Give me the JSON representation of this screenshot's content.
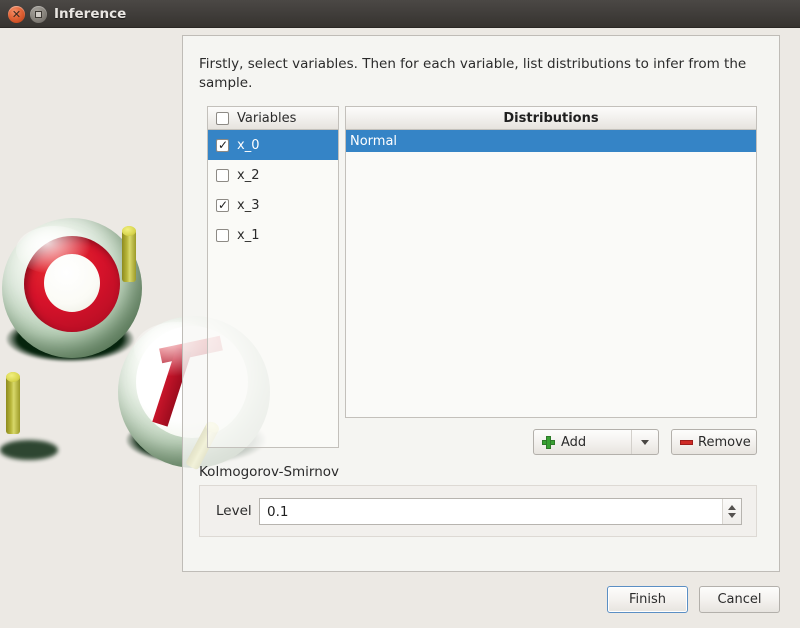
{
  "window": {
    "title": "Inference",
    "close_icon": "close-icon",
    "maximize_icon": "maximize-icon"
  },
  "content": {
    "intro": "Firstly, select variables. Then for each variable, list distributions to infer from the sample."
  },
  "variables_panel": {
    "header_label": "Variables",
    "header_checked": false,
    "rows": [
      {
        "label": "x_0",
        "checked": true,
        "selected": true
      },
      {
        "label": "x_2",
        "checked": false,
        "selected": false
      },
      {
        "label": "x_3",
        "checked": true,
        "selected": false
      },
      {
        "label": "x_1",
        "checked": false,
        "selected": false
      }
    ]
  },
  "distributions_panel": {
    "header_label": "Distributions",
    "rows": [
      {
        "label": "Normal",
        "selected": true
      }
    ],
    "add_button": {
      "label": "Add",
      "icon": "plus-icon",
      "dropdown_icon": "chevron-down-icon"
    },
    "remove_button": {
      "label": "Remove",
      "icon": "minus-icon"
    }
  },
  "kolmogorov_smirnov": {
    "group_label": "Kolmogorov-Smirnov",
    "level_label": "Level",
    "level_value": "0.1"
  },
  "actions": {
    "finish_label": "Finish",
    "cancel_label": "Cancel"
  },
  "colors": {
    "selection_blue": "#3584c6",
    "dialog_background": "#ece9e4",
    "titlebar": "#413e3b",
    "close_button": "#e5693c",
    "add_icon_green": "#38a032",
    "remove_icon_red": "#cf2b26"
  }
}
